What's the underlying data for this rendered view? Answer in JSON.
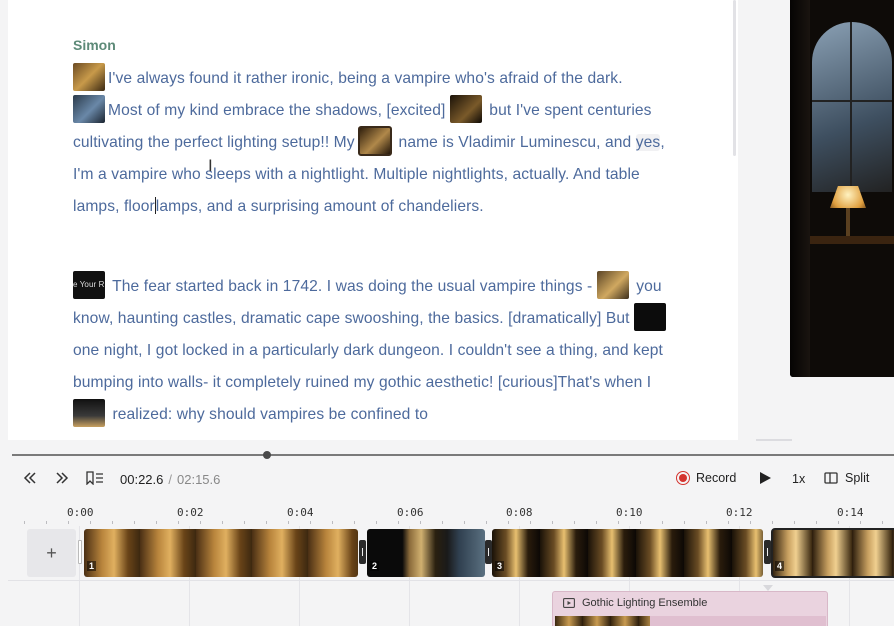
{
  "editor": {
    "speaker": "Simon",
    "p1": {
      "s1": "I've always found it rather ironic, being a vampire who's afraid of the dark.",
      "s2a": "Most of my kind embrace the shadows, [excited]",
      "s2b": "but I've spent centuries cultivating the perfect lighting setup!! My",
      "s3a": "name is Vladimir Luminescu, and",
      "s3hl": "yes",
      "s3b": ", I'm a vampire who sleeps with a nightlight. Multiple nightlights, actually. And table lamps, floor",
      "s3c": "lamps, and a surprising amount of chandeliers."
    },
    "p2": {
      "thumb_text": "e Your R",
      "s1a": "The fear started back in 1742.  I was doing the usual vampire things -",
      "s1b": "you know, haunting castles, dramatic cape swooshing, the basics. [dramatically] But",
      "s2a": "one night, I got locked in a particularly dark dungeon. I couldn't see a thing, and kept bumping into walls- it completely ruined my gothic aesthetic! [curious]That's when I",
      "s2b": "realized: why should vampires be confined to"
    }
  },
  "player": {
    "current_time": "00:22.6",
    "separator": "/",
    "total_time": "02:15.6",
    "progress_fraction": 0.17,
    "record_label": "Record",
    "speed_label": "1x",
    "split_label": "Split",
    "icons": {
      "rewind": "chevron-double-left-icon",
      "forward": "chevron-double-right-icon",
      "bookmark": "bookmark-list-icon",
      "record": "record-icon",
      "play": "play-icon",
      "split": "split-icon"
    }
  },
  "timeline": {
    "ticks": [
      "0:00",
      "0:02",
      "0:04",
      "0:06",
      "0:08",
      "0:10",
      "0:12",
      "0:14"
    ],
    "add_label": "+",
    "clips": [
      {
        "number": "1"
      },
      {
        "number": "2"
      },
      {
        "number": "3"
      },
      {
        "number": "4"
      }
    ],
    "ensemble_label": "Gothic Lighting Ensemble",
    "colors": {
      "record": "#d4342f",
      "speaker": "#5d8a78",
      "script_text": "#4d6a9c",
      "ensemble_bg": "#ead3df"
    }
  }
}
